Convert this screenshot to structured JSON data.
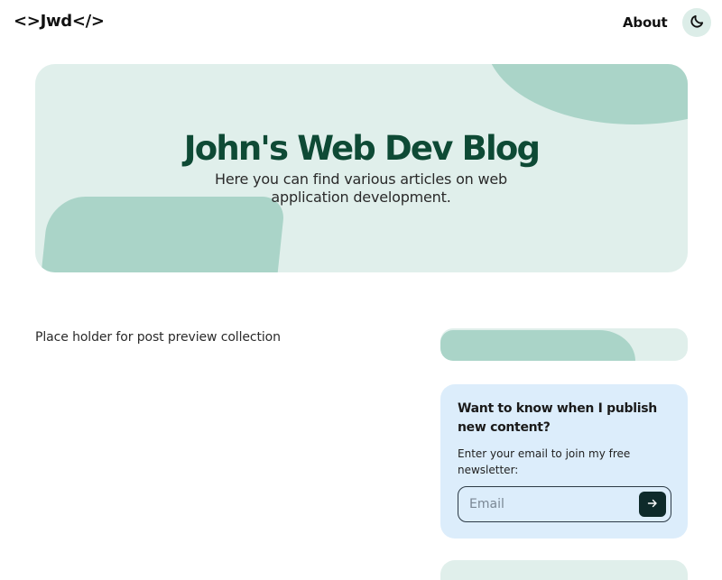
{
  "header": {
    "logo_text": "<>Jwd</>",
    "nav": {
      "about_label": "About"
    },
    "theme_toggle_icon": "moon-icon"
  },
  "hero": {
    "title": "John's Web Dev Blog",
    "subtitle": "Here you can find various articles on web application development."
  },
  "main": {
    "placeholder_text": "Place holder for post preview collection"
  },
  "sidebar": {
    "newsletter": {
      "title": "Want to know when I publish new content?",
      "description": "Enter your email to join my free newsletter:",
      "email_placeholder": "Email",
      "submit_icon": "arrow-right-icon"
    }
  },
  "colors": {
    "hero_bg": "#e0efeb",
    "accent_blob": "#aad4c8",
    "title_green": "#0e4a35",
    "newsletter_bg": "#dcedfb",
    "submit_bg": "#0e2a2a"
  }
}
